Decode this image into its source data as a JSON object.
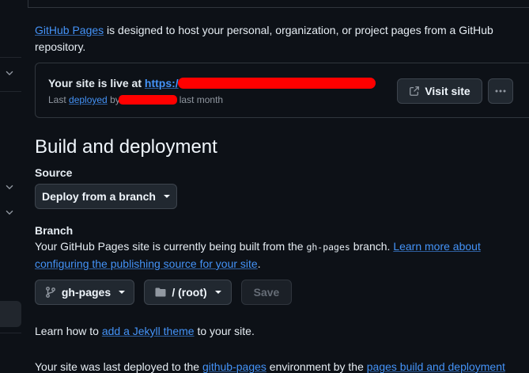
{
  "intro": {
    "link": "GitHub Pages",
    "text": " is designed to host your personal, organization, or project pages from a GitHub repository."
  },
  "live": {
    "prefix": "Your site is live at ",
    "url_visible": "https:/",
    "sub_prefix": "Last ",
    "sub_link": "deployed",
    "sub_by": " by",
    "sub_suffix": "last month",
    "visit_label": "Visit site"
  },
  "build": {
    "title": "Build and deployment",
    "source_label": "Source",
    "source_value": "Deploy from a branch",
    "branch_label": "Branch",
    "branch_text_1": "Your GitHub Pages site is currently being built from the ",
    "branch_code": "gh-pages",
    "branch_text_2": " branch. ",
    "branch_link": "Learn more about configuring the publishing source for your site",
    "branch_text_3": ".",
    "branch_value": "gh-pages",
    "folder_value": "/ (root)",
    "save_label": "Save"
  },
  "jekyll": {
    "prefix": "Learn how to ",
    "link": "add a Jekyll theme",
    "suffix": " to your site."
  },
  "deploy": {
    "text_1": "Your site was last deployed to the ",
    "link_1": "github-pages",
    "text_2": " environment by the ",
    "link_2": "pages build and deployment"
  },
  "icons": {
    "chevron": "chevron-down-icon",
    "external": "link-external-icon",
    "kebab": "kebab-horizontal-icon",
    "branch": "git-branch-icon",
    "folder": "folder-icon"
  },
  "colors": {
    "background": "#0d1117",
    "link": "#4493f8",
    "border": "#30363d",
    "button": "#212830",
    "redaction": "#ff0000"
  }
}
